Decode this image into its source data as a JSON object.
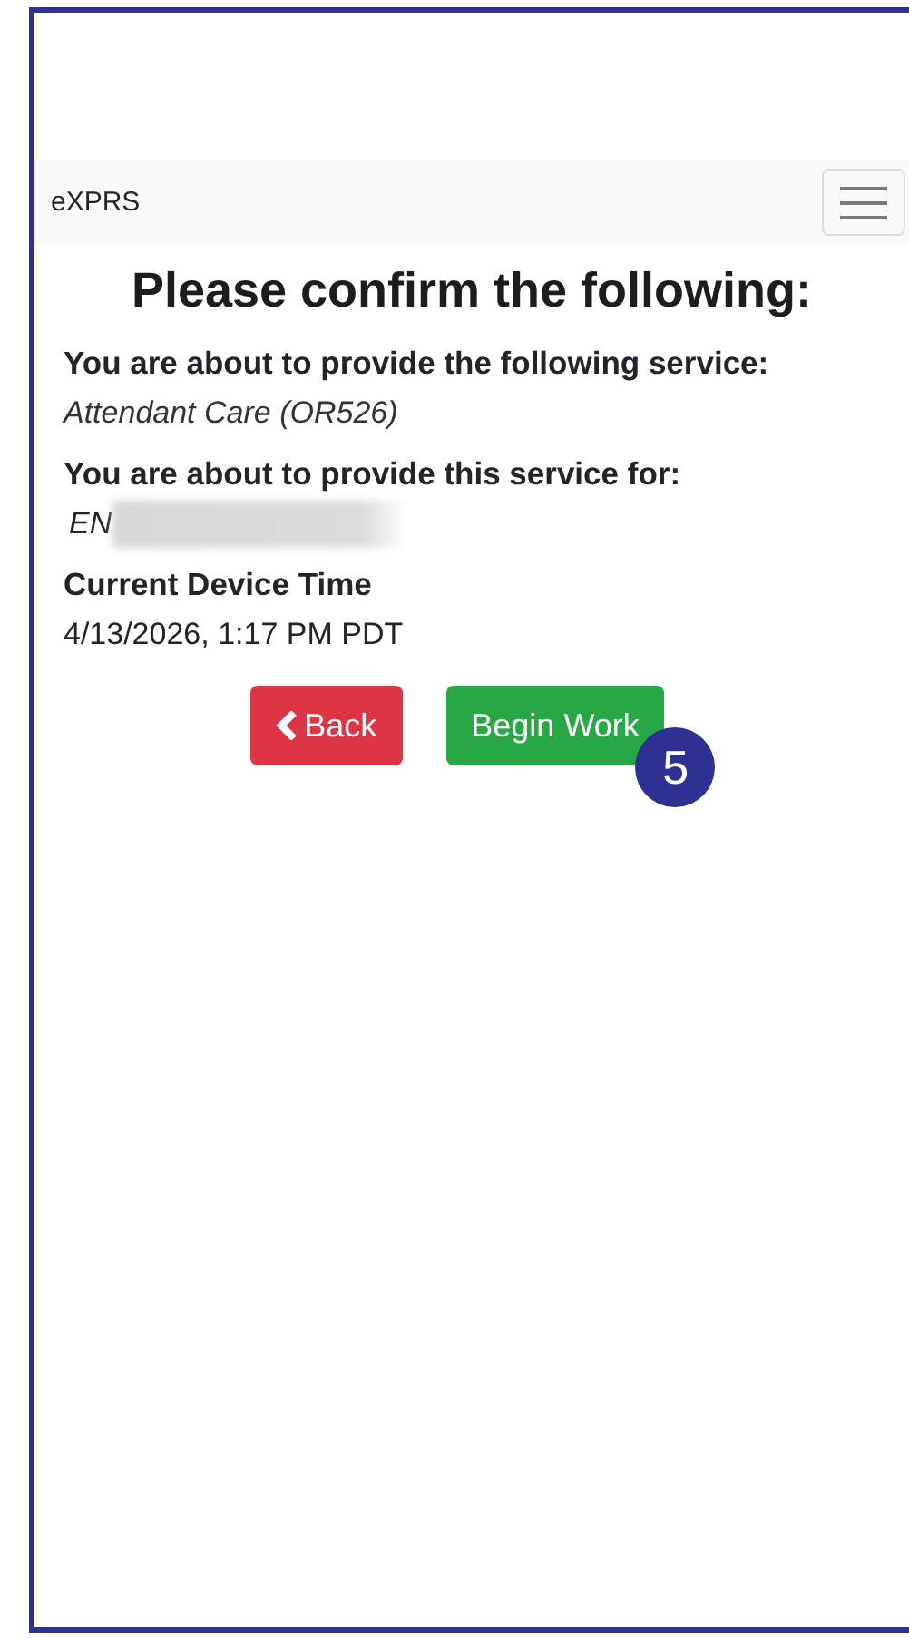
{
  "navbar": {
    "brand": "eXPRS"
  },
  "heading": "Please confirm the following:",
  "sections": [
    {
      "label": "You are about to provide the following service:",
      "value": "Attendant Care (OR526)",
      "kind": "italic"
    },
    {
      "label": "You are about to provide this service for:",
      "value": "EN",
      "kind": "redacted"
    },
    {
      "label": "Current Device Time",
      "value": "4/13/2026, 1:17 PM PDT",
      "kind": "plain"
    }
  ],
  "buttons": [
    {
      "label": "Back",
      "kind": "danger"
    },
    {
      "label": "Begin Work",
      "kind": "success",
      "badge": "5"
    }
  ]
}
